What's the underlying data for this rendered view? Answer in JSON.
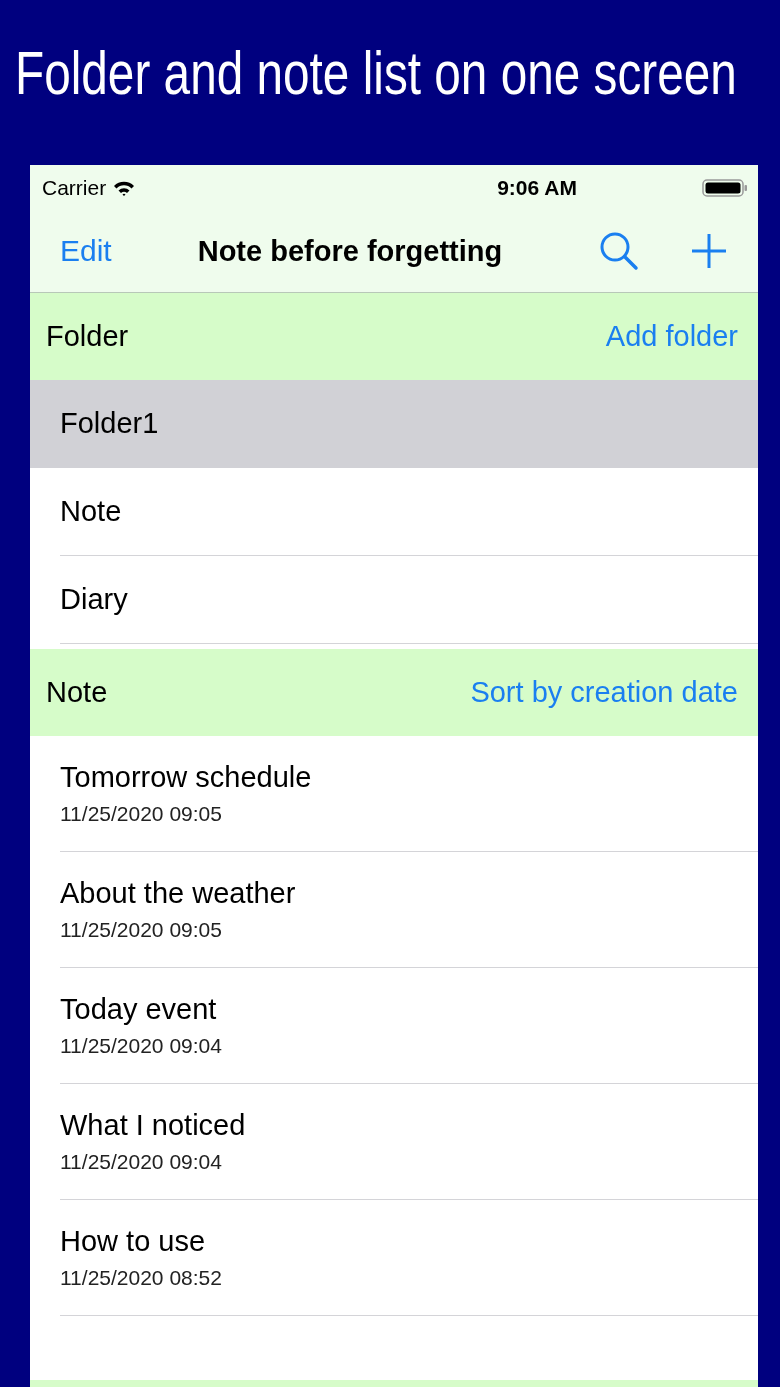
{
  "banner": {
    "title": "Folder and note list on one screen"
  },
  "status_bar": {
    "carrier": "Carrier",
    "time": "9:06 AM"
  },
  "nav_bar": {
    "left_button": "Edit",
    "title": "Note before forgetting"
  },
  "folder_section": {
    "header": "Folder",
    "action": "Add folder",
    "items": [
      {
        "label": "Folder1",
        "selected": true
      },
      {
        "label": "Note",
        "selected": false
      },
      {
        "label": "Diary",
        "selected": false
      }
    ]
  },
  "note_section": {
    "header": "Note",
    "action": "Sort by creation date",
    "items": [
      {
        "title": "Tomorrow schedule",
        "date": "11/25/2020 09:05"
      },
      {
        "title": "About the weather",
        "date": "11/25/2020 09:05"
      },
      {
        "title": "Today event",
        "date": "11/25/2020 09:04"
      },
      {
        "title": "What I noticed",
        "date": "11/25/2020 09:04"
      },
      {
        "title": "How to use",
        "date": "11/25/2020 08:52"
      }
    ]
  }
}
